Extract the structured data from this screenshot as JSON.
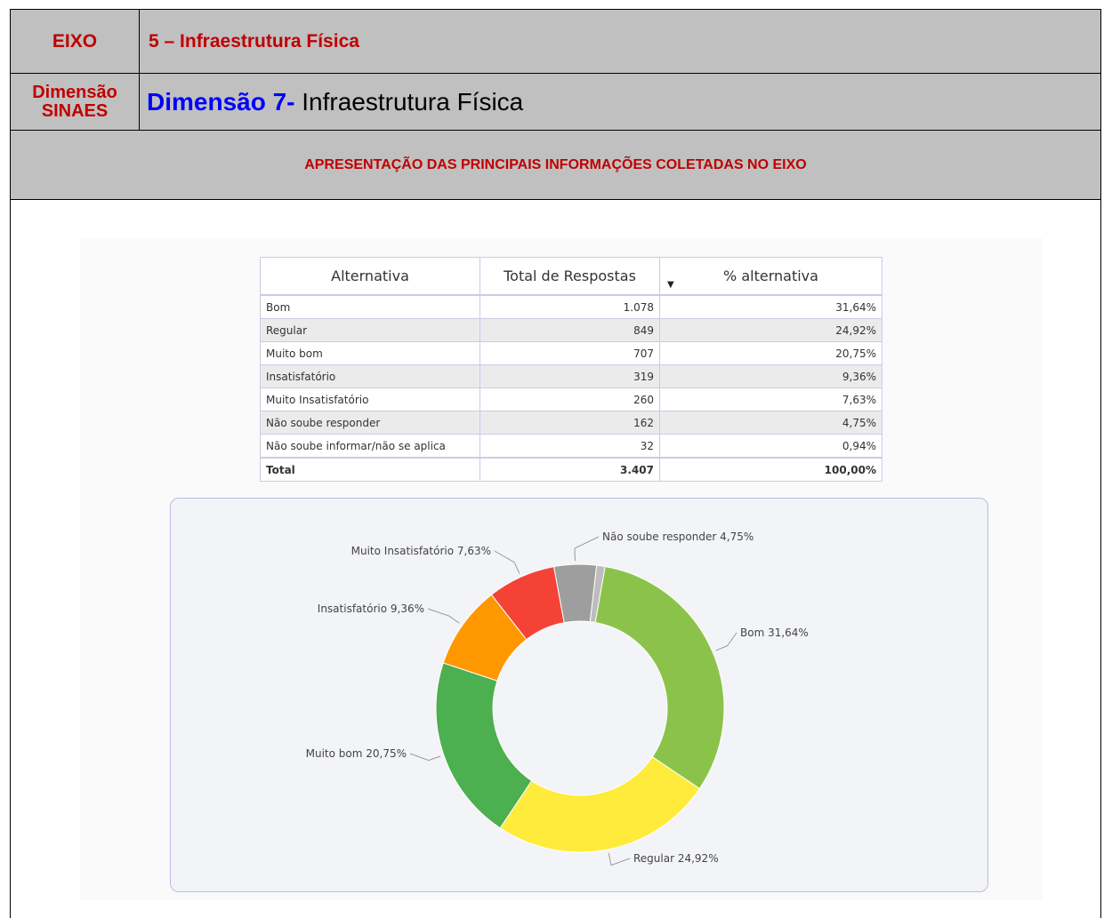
{
  "header": {
    "eixo_label": "EIXO",
    "eixo_value": "5 – Infraestrutura Física",
    "dimensao_label_line1": "Dimensão",
    "dimensao_label_line2": "SINAES",
    "dimensao_prefix": "Dimensão 7-",
    "dimensao_value": " Infraestrutura Física",
    "section_title": "APRESENTAÇÃO DAS PRINCIPAIS INFORMAÇÕES COLETADAS NO EIXO"
  },
  "table": {
    "columns": [
      "Alternativa",
      "Total de Respostas",
      "% alternativa"
    ],
    "rows": [
      {
        "alternativa": "Bom",
        "total": "1.078",
        "pct": "31,64%"
      },
      {
        "alternativa": "Regular",
        "total": "849",
        "pct": "24,92%"
      },
      {
        "alternativa": "Muito bom",
        "total": "707",
        "pct": "20,75%"
      },
      {
        "alternativa": "Insatisfatório",
        "total": "319",
        "pct": "9,36%"
      },
      {
        "alternativa": "Muito Insatisfatório",
        "total": "260",
        "pct": "7,63%"
      },
      {
        "alternativa": "Não soube responder",
        "total": "162",
        "pct": "4,75%"
      },
      {
        "alternativa": "Não soube informar/não se aplica",
        "total": "32",
        "pct": "0,94%"
      }
    ],
    "total_row": {
      "alternativa": "Total",
      "total": "3.407",
      "pct": "100,00%"
    }
  },
  "chart_data": {
    "type": "pie",
    "variant": "donut",
    "slices": [
      {
        "name": "Bom",
        "value": 31.64,
        "label": "Bom 31,64%",
        "color": "#8bc34a"
      },
      {
        "name": "Regular",
        "value": 24.92,
        "label": "Regular 24,92%",
        "color": "#ffeb3b"
      },
      {
        "name": "Muito bom",
        "value": 20.75,
        "label": "Muito bom 20,75%",
        "color": "#4caf50"
      },
      {
        "name": "Insatisfatório",
        "value": 9.36,
        "label": "Insatisfatório 9,36%",
        "color": "#ff9800"
      },
      {
        "name": "Muito Insatisfatório",
        "value": 7.63,
        "label": "Muito Insatisfatório 7,63%",
        "color": "#f44336"
      },
      {
        "name": "Não soube responder",
        "value": 4.75,
        "label": "Não soube responder 4,75%",
        "color": "#9e9e9e"
      },
      {
        "name": "Não soube informar/não se aplica",
        "value": 0.94,
        "label": "",
        "color": "#bdbdbd"
      }
    ]
  }
}
